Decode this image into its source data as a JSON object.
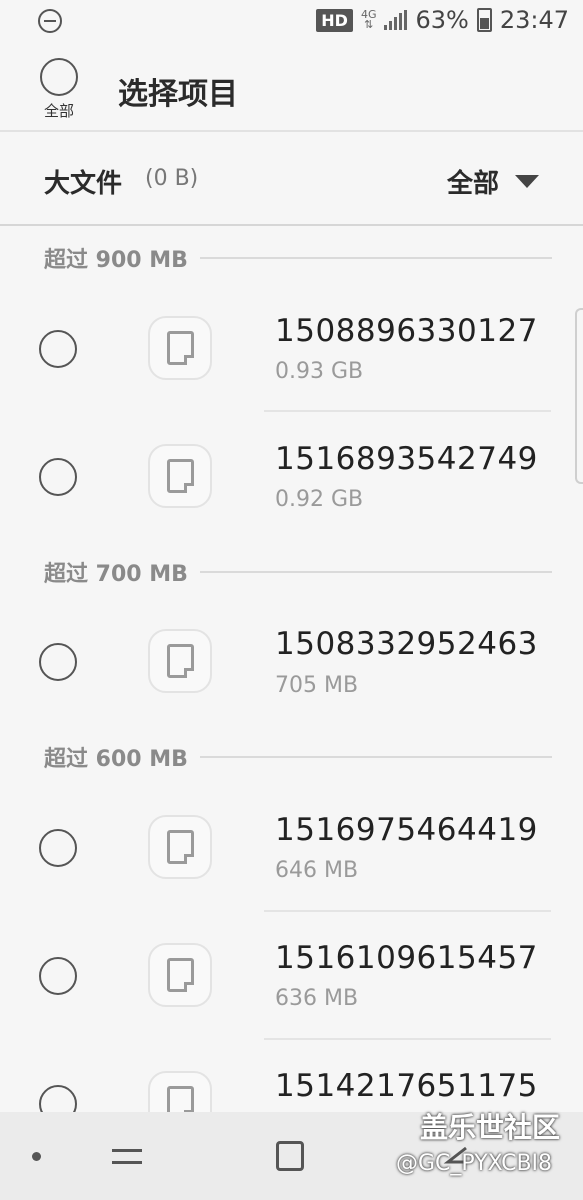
{
  "status": {
    "hd": "HD",
    "network": "4G",
    "battery": "63%",
    "time": "23:47"
  },
  "header": {
    "select_all_label": "全部",
    "title": "选择项目"
  },
  "filter": {
    "title": "大文件",
    "total_size": "(0 B)",
    "dropdown_value": "全部"
  },
  "sections": [
    {
      "label": "超过 900 MB",
      "items": [
        {
          "name": "1508896330127",
          "size": "0.93 GB"
        },
        {
          "name": "1516893542749",
          "size": "0.92 GB"
        }
      ]
    },
    {
      "label": "超过 700 MB",
      "items": [
        {
          "name": "1508332952463",
          "size": "705 MB"
        }
      ]
    },
    {
      "label": "超过 600 MB",
      "items": [
        {
          "name": "1516975464419",
          "size": "646 MB"
        },
        {
          "name": "1516109615457",
          "size": "636 MB"
        },
        {
          "name": "1514217651175",
          "size": ""
        }
      ]
    }
  ],
  "watermark": {
    "title": "盖乐世社区",
    "user": "@GC_PYXCBI8"
  }
}
